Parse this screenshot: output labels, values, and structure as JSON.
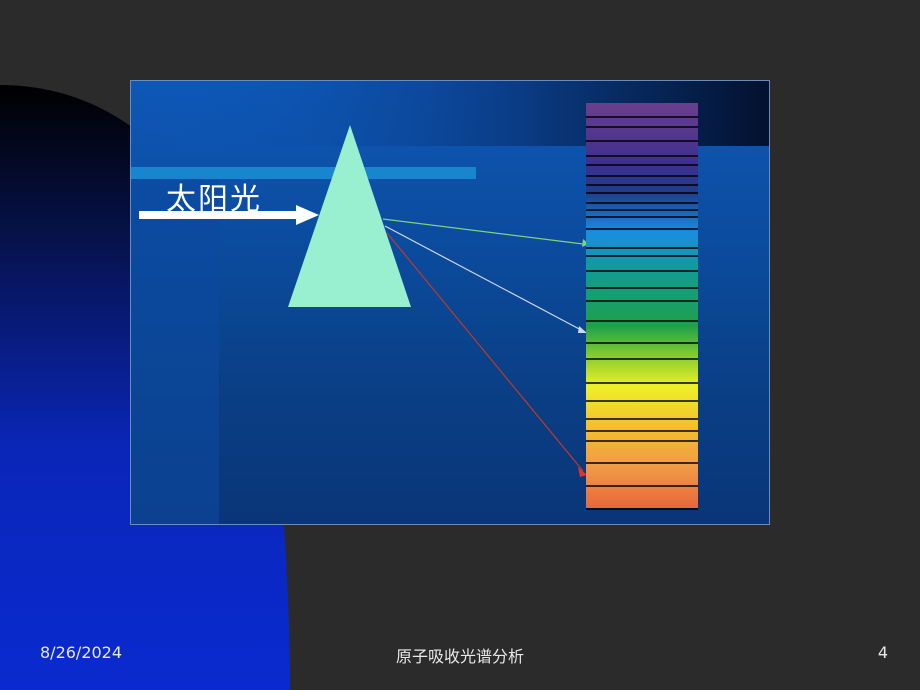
{
  "slide": {
    "date": "8/26/2024",
    "title": "原子吸收光谱分析",
    "page_number": "4"
  },
  "figure": {
    "sunlight_label": "太阳光",
    "arrow_colors": {
      "green": "#7dd37a",
      "white": "#cfd8ea",
      "red": "#c0392b"
    },
    "prism_color": "#98f0d0"
  }
}
